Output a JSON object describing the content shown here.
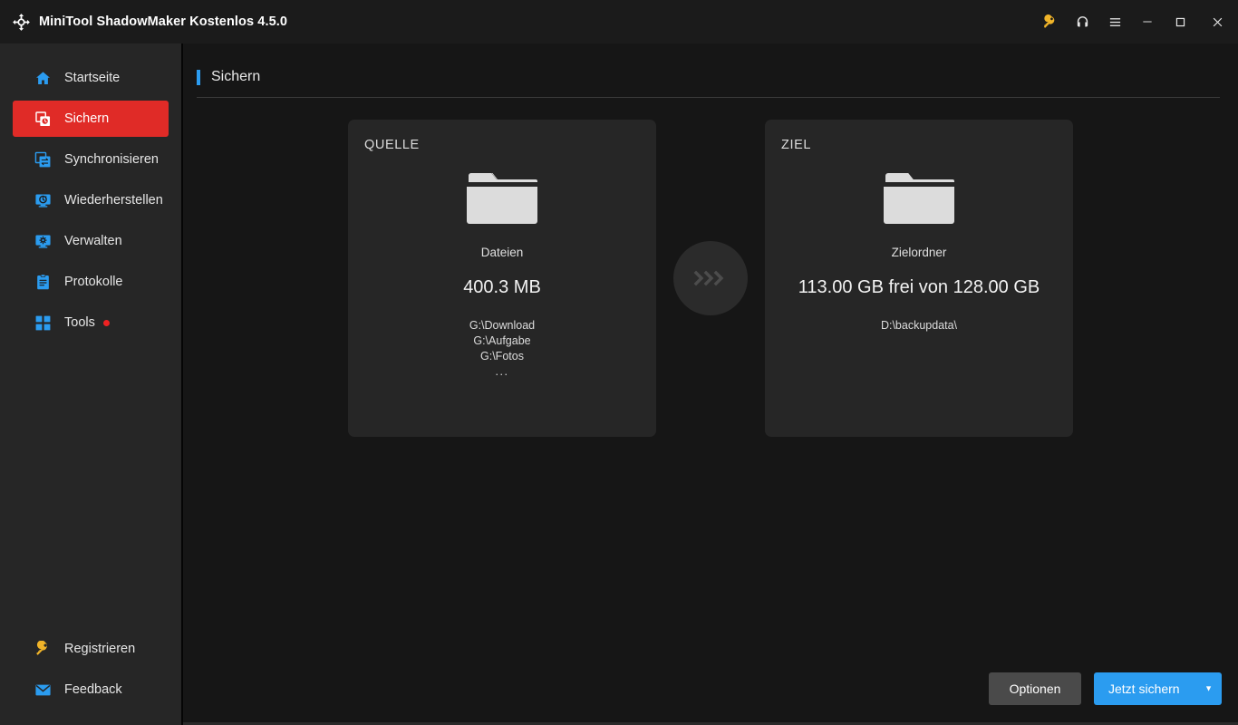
{
  "window": {
    "title": "MiniTool ShadowMaker Kostenlos 4.5.0",
    "logo_icon": "sync-arrows-logo-icon",
    "controls": [
      {
        "name": "license-key-button",
        "icon": "key-icon",
        "glyph": "⚷",
        "color": "#f0b429"
      },
      {
        "name": "support-button",
        "icon": "headset-icon",
        "glyph": "⌨",
        "color": "#e8e8e8"
      },
      {
        "name": "menu-button",
        "icon": "hamburger-menu-icon",
        "glyph": "☰",
        "color": "#e8e8e8"
      },
      {
        "name": "minimize-button",
        "icon": "minimize-icon",
        "glyph": "—",
        "color": "#e8e8e8"
      },
      {
        "name": "maximize-button",
        "icon": "maximize-icon",
        "glyph": "□",
        "color": "#e8e8e8"
      },
      {
        "name": "close-button",
        "icon": "close-icon",
        "glyph": "✕",
        "color": "#e8e8e8"
      }
    ]
  },
  "sidebar": {
    "items": [
      {
        "label": "Startseite",
        "icon": "home-icon",
        "active": false
      },
      {
        "label": "Sichern",
        "icon": "backup-icon",
        "active": true
      },
      {
        "label": "Synchronisieren",
        "icon": "sync-icon",
        "active": false
      },
      {
        "label": "Wiederherstellen",
        "icon": "restore-icon",
        "active": false
      },
      {
        "label": "Verwalten",
        "icon": "manage-icon",
        "active": false
      },
      {
        "label": "Protokolle",
        "icon": "logs-icon",
        "active": false
      },
      {
        "label": "Tools",
        "icon": "tools-grid-icon",
        "active": false,
        "badge": true
      }
    ],
    "bottom_items": [
      {
        "label": "Registrieren",
        "icon": "key-icon"
      },
      {
        "label": "Feedback",
        "icon": "envelope-icon"
      }
    ]
  },
  "page": {
    "title": "Sichern",
    "accent_color": "#2b9cf0"
  },
  "source_card": {
    "label": "QUELLE",
    "icon": "folder-icon",
    "kind": "Dateien",
    "size": "400.3 MB",
    "paths": [
      "G:\\Download",
      "G:\\Aufgabe",
      "G:\\Fotos"
    ],
    "paths_ellipsis": "..."
  },
  "connector": {
    "icon": "triple-chevron-right-icon",
    "glyph": "›››"
  },
  "destination_card": {
    "label": "ZIEL",
    "icon": "folder-icon",
    "kind": "Zielordner",
    "capacity": "113.00 GB frei von 128.00 GB",
    "path": "D:\\backupdata\\"
  },
  "footer": {
    "options_label": "Optionen",
    "backup_now_label": "Jetzt sichern",
    "dropdown_glyph": "▼",
    "primary_color": "#2b9cf0"
  }
}
